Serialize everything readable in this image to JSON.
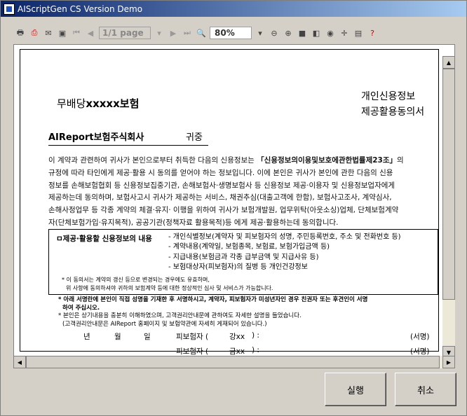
{
  "window": {
    "title": "AIScriptGen CS Version Demo"
  },
  "toolbar": {
    "page": "1/1 page",
    "zoom": "80%",
    "icons": [
      "print-icon",
      "print-setup-icon",
      "email-icon",
      "save-icon",
      "first-page-icon",
      "prev-page-icon",
      "next-page-icon",
      "last-page-icon",
      "zoom-in-icon",
      "zoom-out-icon",
      "zoom-icon",
      "whole-page-icon",
      "page-width-icon",
      "find-icon",
      "crosshair-icon",
      "notes-icon",
      "help-icon"
    ]
  },
  "doc": {
    "company_prefix": "무배당",
    "company_name": "xxxxx보험",
    "title_line1": "개인신용정보",
    "title_line2": "제공활용동의서",
    "recipient": "AIReport보험주식회사",
    "recipient_suffix": "귀중",
    "p1_start": "이 계약과 관련하여 귀사가 본인으로부터 취득한 다음의 신용정보는 ",
    "p1_law": "「신용정보의이용및보호에관한법률제23조」",
    "p1_end": "의",
    "p2": "규정에 따라 타인에게 제공·활용 시 동의를 얻어야 하는 정보입니다. 이에 본인은 귀사가 본인에 관한 다음의 신용",
    "p3": "정보를 손해보험협회 등 신용정보집중기관, 손해보험사·생명보험사 등 신용정보 제공·이용자 및 신용정보업자에게",
    "p4": "제공하는데 동의하며, 보험사고시 귀사가 제공하는 서비스, 채권추심(대출고객에 한함), 보험사고조사, 계약심사,",
    "p5": "손해사정업무 등 각종 계약의 체결·유지· 이행을 위하여 귀사가 보험개발원, 업무위탁(아웃소싱)업체, 단체보험계약",
    "p6": "자(단체보험가입·유지목적), 공공기관(정책자료 활용목적)등 에게 제공·활용하는데 동의합니다.",
    "info_label": "ㅁ제공·활용할 신용정보의 내용",
    "info_items": [
      "- 개인식별정보(계약자 및 피보험자의 성명, 주민등록번호, 주소 및 전화번호 등)",
      "- 계약내용(계약일, 보험종목, 보험료, 보험가입금액 등)",
      "- 지급내용(보험금과 각종 급부금액 및 지급사유 등)",
      "- 보험대상자(피보험자)의 질병 등 개인건강정보"
    ],
    "note1": "* 이 동의서는 계약의 갱신 등으로 변경되는 경우에도 유효하며,",
    "note2": "위 사항에 동의하셔야 귀하의 보험계약 등에 대한 정상적인 심사 및 서비스가 가능합니다.",
    "bottom1": "* 아래 서명란에 본인이 직접 성명을 기재한 후 서명하시고, 계약자, 피보험자가 미성년자인 경우 친권자 또는 후견인이 서명",
    "bottom1b": "하여 주십시오.",
    "bottom2": "* 본인은 상기내용을 충분히 이해하였으며, 고객권리안내문에 관하여도 자세한 설명을 들었습니다.",
    "bottom3": "(고객권리안내문은 AIReport 홈페이지 및 보험약관에 자세히 게재되어 있습니다.)",
    "date_year": "년",
    "date_month": "월",
    "date_day": "일",
    "sign_rows": [
      {
        "label": "피보험자 (",
        "name": "강xx",
        "colon": ")  :",
        "sign": "(서명)"
      },
      {
        "label": "피보험자 (",
        "name": "금xx",
        "colon": ")  :",
        "sign": "(서명)"
      }
    ]
  },
  "buttons": {
    "run": "실행",
    "cancel": "취소"
  }
}
